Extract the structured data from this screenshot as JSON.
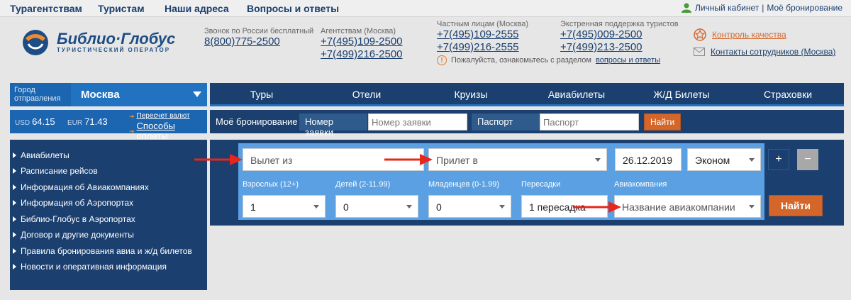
{
  "topnav": {
    "items": [
      "Турагентствам",
      "Туристам",
      "Наши адреса",
      "Вопросы и ответы"
    ],
    "cabinet": "Личный кабинет",
    "my_booking": "Моё бронирование"
  },
  "logo": {
    "name": "Библио·Глобус",
    "subtitle": "ТУРИСТИЧЕСКИЙ ОПЕРАТОР"
  },
  "contacts": {
    "free": {
      "label": "Звонок по России бесплатный",
      "phones": [
        "8(800)775-2500"
      ]
    },
    "agencies": {
      "label": "Агентствам (Москва)",
      "phones": [
        "+7(495)109-2500",
        "+7(499)216-2500"
      ]
    },
    "private": {
      "label": "Частным лицам (Москва)",
      "phones": [
        "+7(495)109-2555",
        "+7(499)216-2555"
      ]
    },
    "emergency": {
      "label": "Экстренная поддержка туристов",
      "phones": [
        "+7(495)009-2500",
        "+7(499)213-2500"
      ]
    },
    "notice_text": "Пожалуйста, ознакомьтесь с разделом",
    "notice_link": "вопросы и ответы"
  },
  "side_links": {
    "quality": "Контроль качества",
    "staff": "Контакты сотрудников (Москва)"
  },
  "city": {
    "label": "Город отправления",
    "value": "Москва"
  },
  "mainnav": [
    "Туры",
    "Отели",
    "Круизы",
    "Авиабилеты",
    "Ж/Д Билеты",
    "Страховки"
  ],
  "rates": {
    "usd_label": "USD",
    "usd": "64.15",
    "eur_label": "EUR",
    "eur": "71.43",
    "recalc": "Пересчет валют",
    "payment": "Способы оплаты"
  },
  "booking": {
    "title": "Моё бронирование",
    "order_label": "Номер заявки",
    "order_placeholder": "Номер заявки",
    "passport_label": "Паспорт",
    "passport_placeholder": "Паспорт",
    "find": "Найти"
  },
  "sidebar": [
    "Авиабилеты",
    "Расписание рейсов",
    "Информация об Авиакомпаниях",
    "Информация об Аэропортах",
    "Библио-Глобус в Аэропортах",
    "Договор и другие документы",
    "Правила бронирования авиа и ж/д билетов",
    "Новости и оперативная информация"
  ],
  "search": {
    "from_placeholder": "Вылет из",
    "to_placeholder": "Прилет в",
    "date": "26.12.2019",
    "class": "Эконом",
    "plus": "+",
    "minus": "−",
    "adults_label": "Взрослых (12+)",
    "adults": "1",
    "children_label": "Детей (2-11.99)",
    "children": "0",
    "infants_label": "Младенцев (0-1.99)",
    "infants": "0",
    "transfers_label": "Пересадки",
    "transfers": "1 пересадка",
    "airline_label": "Авиакомпания",
    "airline_placeholder": "Название авиакомпании",
    "find": "Найти"
  },
  "colors": {
    "navy": "#1b3f6e",
    "blue": "#1b65b1",
    "panel": "#5aa0e3",
    "orange": "#d4662a",
    "arrow": "#e8261b"
  }
}
